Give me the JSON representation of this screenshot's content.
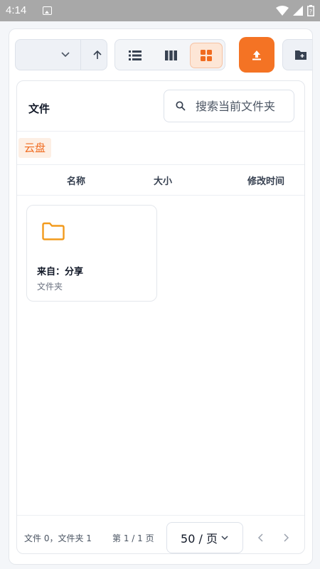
{
  "status_bar": {
    "time": "4:14"
  },
  "toolbar": {
    "view_modes": [
      "list",
      "columns",
      "grid"
    ],
    "active_view": "grid"
  },
  "card": {
    "title": "文件",
    "search_placeholder": "搜索当前文件夹",
    "breadcrumb": "云盘",
    "columns": {
      "name": "名称",
      "size": "大小",
      "modified": "修改时间"
    }
  },
  "files": [
    {
      "name": "来自：分享",
      "type": "文件夹",
      "icon": "folder-icon"
    }
  ],
  "footer": {
    "count": "文件 0，文件夹 1",
    "page": "第 1 / 1 页",
    "per_page": "50 / 页"
  },
  "colors": {
    "accent": "#f47324",
    "folder": "#f29a1c"
  }
}
